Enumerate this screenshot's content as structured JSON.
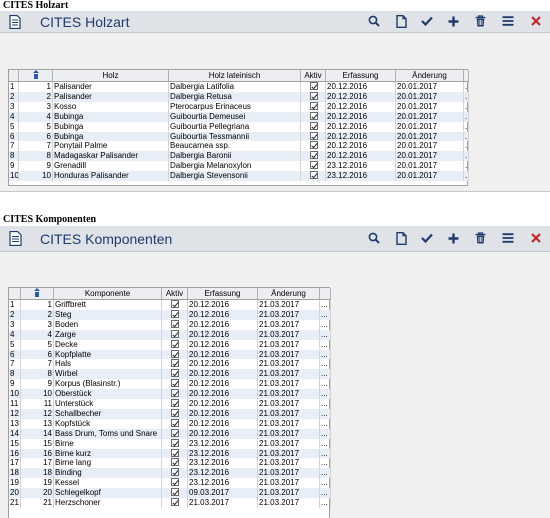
{
  "holzart": {
    "section_title": "CITES Holzart",
    "toolbar_title": "CITES Holzart",
    "columns": [
      "ID",
      "Holz",
      "Holz lateinisch",
      "Aktiv",
      "Erfassung",
      "Änderung",
      "..."
    ],
    "rows": [
      {
        "n": "1",
        "id": "1",
        "name": "Palisander",
        "latin": "Dalbergia Latifolia",
        "created": "20.12.2016",
        "changed": "20.01.2017",
        "more": "..."
      },
      {
        "n": "2",
        "id": "2",
        "name": "Palisander",
        "latin": "Dalbergia Retusa",
        "created": "20.12.2016",
        "changed": "20.01.2017",
        "more": "..."
      },
      {
        "n": "3",
        "id": "3",
        "name": "Kosso",
        "latin": "Pterocarpus Erinaceus",
        "created": "20.12.2016",
        "changed": "20.01.2017",
        "more": "..."
      },
      {
        "n": "4",
        "id": "4",
        "name": "Bubinga",
        "latin": "Guibourtia Demeusei",
        "created": "20.12.2016",
        "changed": "20.01.2017",
        "more": "..."
      },
      {
        "n": "5",
        "id": "5",
        "name": "Bubinga",
        "latin": "Guibourtia Pellegriana",
        "created": "20.12.2016",
        "changed": "20.01.2017",
        "more": "..."
      },
      {
        "n": "6",
        "id": "6",
        "name": "Bubinga",
        "latin": "Guibourtia Tessmannii",
        "created": "20.12.2016",
        "changed": "20.01.2017",
        "more": "..."
      },
      {
        "n": "7",
        "id": "7",
        "name": "Ponytail Palme",
        "latin": "Beaucarnea ssp.",
        "created": "20.12.2016",
        "changed": "20.01.2017",
        "more": "..."
      },
      {
        "n": "8",
        "id": "8",
        "name": "Madagaskar Palisander",
        "latin": "Dalbergia Baronii",
        "created": "20.12.2016",
        "changed": "20.01.2017",
        "more": "..."
      },
      {
        "n": "9",
        "id": "9",
        "name": "Grenadill",
        "latin": "Dalbergia Melanoxylon",
        "created": "23.12.2016",
        "changed": "20.01.2017",
        "more": "..."
      },
      {
        "n": "10",
        "id": "10",
        "name": "Honduras Palisander",
        "latin": "Dalbergia Stevensonii",
        "created": "23.12.2016",
        "changed": "20.01.2017",
        "more": "..."
      }
    ]
  },
  "komponenten": {
    "section_title": "CITES Komponenten",
    "toolbar_title": "CITES Komponenten",
    "columns": [
      "ID",
      "Komponente",
      "Aktiv",
      "Erfassung",
      "Änderung",
      "..."
    ],
    "rows": [
      {
        "n": "1",
        "id": "1",
        "name": "Griffbrett",
        "created": "20.12.2016",
        "changed": "21.03.2017",
        "more": "..."
      },
      {
        "n": "2",
        "id": "2",
        "name": "Steg",
        "created": "20.12.2016",
        "changed": "21.03.2017",
        "more": "..."
      },
      {
        "n": "3",
        "id": "3",
        "name": "Boden",
        "created": "20.12.2016",
        "changed": "21.03.2017",
        "more": "..."
      },
      {
        "n": "4",
        "id": "4",
        "name": "Zarge",
        "created": "20.12.2016",
        "changed": "21.03.2017",
        "more": "..."
      },
      {
        "n": "5",
        "id": "5",
        "name": "Decke",
        "created": "20.12.2016",
        "changed": "21.03.2017",
        "more": "..."
      },
      {
        "n": "6",
        "id": "6",
        "name": "Kopfplatte",
        "created": "20.12.2016",
        "changed": "21.03.2017",
        "more": "..."
      },
      {
        "n": "7",
        "id": "7",
        "name": "Hals",
        "created": "20.12.2016",
        "changed": "21.03.2017",
        "more": "..."
      },
      {
        "n": "8",
        "id": "8",
        "name": "Wirbel",
        "created": "20.12.2016",
        "changed": "21.03.2017",
        "more": "..."
      },
      {
        "n": "9",
        "id": "9",
        "name": "Korpus (Blasinstr.)",
        "created": "20.12.2016",
        "changed": "21.03.2017",
        "more": "..."
      },
      {
        "n": "10",
        "id": "10",
        "name": "Oberstück",
        "created": "20.12.2016",
        "changed": "21.03.2017",
        "more": "..."
      },
      {
        "n": "11",
        "id": "11",
        "name": "Unterstück",
        "created": "20.12.2016",
        "changed": "21.03.2017",
        "more": "..."
      },
      {
        "n": "12",
        "id": "12",
        "name": "Schallbecher",
        "created": "20.12.2016",
        "changed": "21.03.2017",
        "more": "..."
      },
      {
        "n": "13",
        "id": "13",
        "name": "Kopfstück",
        "created": "20.12.2016",
        "changed": "21.03.2017",
        "more": "..."
      },
      {
        "n": "14",
        "id": "14",
        "name": "Bass Drum, Toms und Snare",
        "created": "20.12.2016",
        "changed": "21.03.2017",
        "more": "..."
      },
      {
        "n": "15",
        "id": "15",
        "name": "Birne",
        "created": "23.12.2016",
        "changed": "21.03.2017",
        "more": "..."
      },
      {
        "n": "16",
        "id": "16",
        "name": "Birne kurz",
        "created": "23.12.2016",
        "changed": "21.03.2017",
        "more": "..."
      },
      {
        "n": "17",
        "id": "17",
        "name": "Birne lang",
        "created": "23.12.2016",
        "changed": "21.03.2017",
        "more": "..."
      },
      {
        "n": "18",
        "id": "18",
        "name": "Binding",
        "created": "23.12.2016",
        "changed": "21.03.2017",
        "more": "..."
      },
      {
        "n": "19",
        "id": "19",
        "name": "Kessel",
        "created": "23.12.2016",
        "changed": "21.03.2017",
        "more": "..."
      },
      {
        "n": "20",
        "id": "20",
        "name": "Schlegelkopf",
        "created": "09.03.2017",
        "changed": "21.03.2017",
        "more": "..."
      },
      {
        "n": "21",
        "id": "21",
        "name": "Herzschoner",
        "created": "21.03.2017",
        "changed": "21.03.2017",
        "more": "..."
      }
    ]
  },
  "toolbar_buttons": [
    {
      "icon": "search-icon",
      "color": "#1f3a6b"
    },
    {
      "icon": "new-document-icon",
      "color": "#1f3a6b"
    },
    {
      "icon": "checkmark-icon",
      "color": "#1f3a6b"
    },
    {
      "icon": "plus-icon",
      "color": "#1f3a6b"
    },
    {
      "icon": "trash-icon",
      "color": "#1f3a6b"
    },
    {
      "icon": "menu-icon",
      "color": "#1f3a6b"
    },
    {
      "icon": "close-icon",
      "color": "#c0282d"
    }
  ],
  "colors": {
    "accent": "#1f3a6b",
    "close": "#c0282d",
    "toolbar_bg": "#dfe3e8",
    "row_alt": "#e7eef8"
  }
}
